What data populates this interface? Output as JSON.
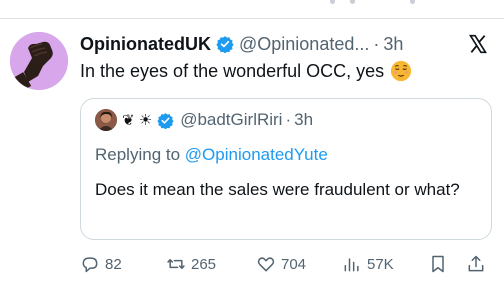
{
  "tweet": {
    "author_name": "OpinionatedUK",
    "handle": "@Opinionated...",
    "separator": "·",
    "time": "3h",
    "text": "In the eyes of the wonderful OCC, yes"
  },
  "quoted": {
    "emoji_glyphs": "❦ ☀",
    "handle": "@badtGirlRiri",
    "separator": "·",
    "time": "3h",
    "replying_prefix": "Replying to",
    "replying_mention": "@OpinionatedYute",
    "text": "Does it mean the sales were fraudulent or what?"
  },
  "actions": {
    "replies": "82",
    "reposts": "265",
    "likes": "704",
    "views": "57K"
  },
  "icons": {
    "verified": "verified-badge-icon",
    "x_logo": "x-logo-icon",
    "emoji": "relieved-face-emoji",
    "reply": "reply-icon",
    "repost": "repost-icon",
    "like": "heart-icon",
    "views": "views-chart-icon",
    "bookmark": "bookmark-icon",
    "share": "share-icon"
  },
  "colors": {
    "accent": "#1d9bf0",
    "text": "#0f1419",
    "muted": "#536471",
    "avatar_bg": "#d8a6ea",
    "border": "#cfd9de"
  }
}
